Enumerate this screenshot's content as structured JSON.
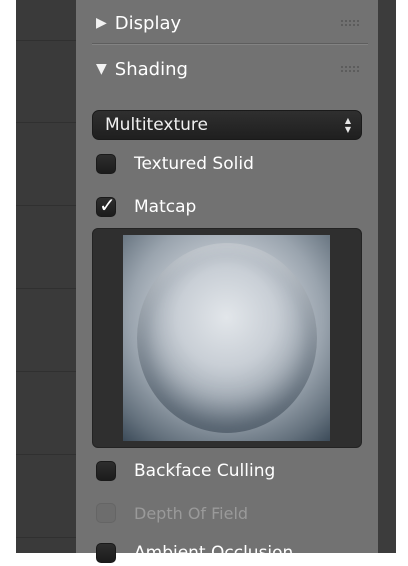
{
  "panel": {
    "sections": [
      {
        "label": "Display",
        "expanded": false
      },
      {
        "label": "Shading",
        "expanded": true
      }
    ]
  },
  "shading": {
    "mode_selected": "Multitexture",
    "options": [
      {
        "label": "Textured Solid",
        "checked": false,
        "enabled": true
      },
      {
        "label": "Matcap",
        "checked": true,
        "enabled": true
      },
      {
        "label": "Backface Culling",
        "checked": false,
        "enabled": true
      },
      {
        "label": "Depth Of Field",
        "checked": false,
        "enabled": false
      },
      {
        "label": "Ambient Occlusion",
        "checked": false,
        "enabled": true
      }
    ]
  },
  "icons": {
    "collapsed": "triangle-right-icon",
    "expanded": "triangle-down-icon",
    "dropdown": "updown-arrows-icon",
    "check": "checkmark-icon",
    "grip": "drag-grip-icon"
  },
  "colors": {
    "panel_bg": "#727272",
    "widget_bg": "#262626",
    "text": "#ffffff",
    "disabled_text": "#9a9a9a"
  }
}
